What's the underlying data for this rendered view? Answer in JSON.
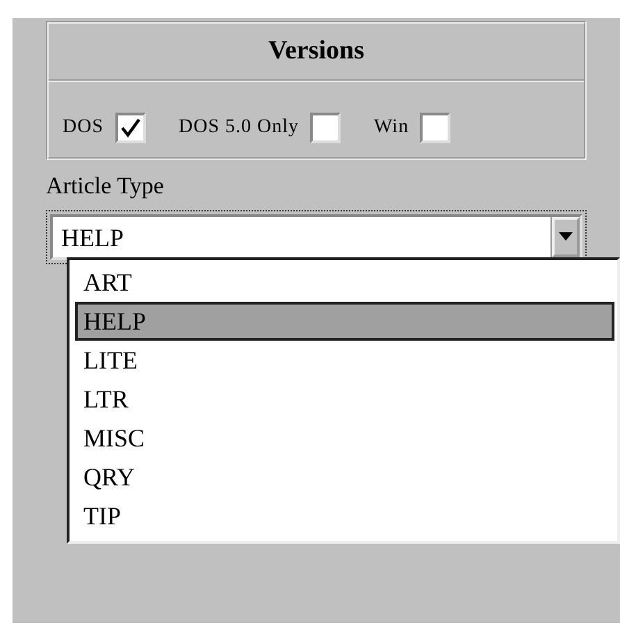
{
  "versions": {
    "title": "Versions",
    "options": [
      {
        "label": "DOS",
        "checked": true
      },
      {
        "label": "DOS 5.0 Only",
        "checked": false
      },
      {
        "label": "Win",
        "checked": false
      }
    ]
  },
  "article_type": {
    "label": "Article Type",
    "value": "HELP",
    "expanded": true,
    "options": [
      {
        "label": "ART",
        "selected": false
      },
      {
        "label": "HELP",
        "selected": true
      },
      {
        "label": "LITE",
        "selected": false
      },
      {
        "label": "LTR",
        "selected": false
      },
      {
        "label": "MISC",
        "selected": false
      },
      {
        "label": "QRY",
        "selected": false
      },
      {
        "label": "TIP",
        "selected": false
      }
    ]
  }
}
